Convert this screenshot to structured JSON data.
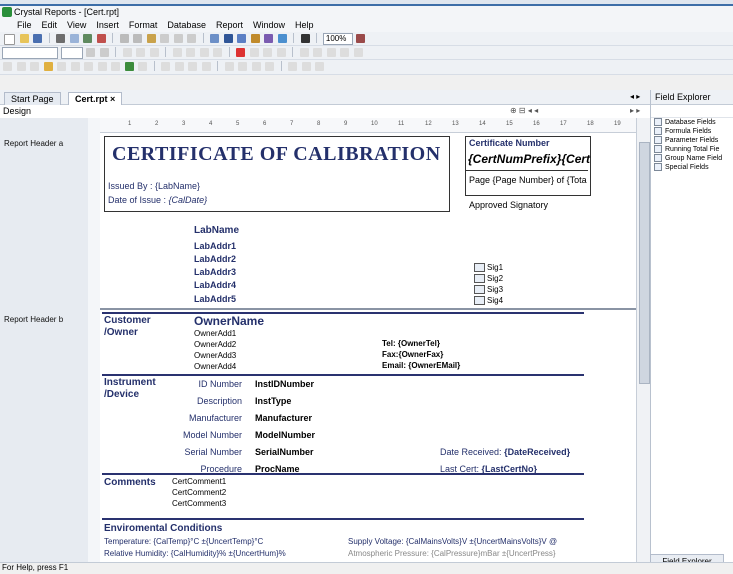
{
  "window": {
    "title": "Crystal Reports - [Cert.rpt]"
  },
  "menu": [
    "File",
    "Edit",
    "View",
    "Insert",
    "Format",
    "Database",
    "Report",
    "Window",
    "Help"
  ],
  "toolbar": {
    "zoom": "100%"
  },
  "tabs": [
    {
      "label": "Start Page"
    },
    {
      "label": "Cert.rpt"
    }
  ],
  "design_label": "Design",
  "sections": {
    "header_a": "Report Header a",
    "header_b": "Report Header b"
  },
  "ruler_numbers": [
    "1",
    "2",
    "3",
    "4",
    "5",
    "6",
    "7",
    "8",
    "9",
    "10",
    "11",
    "12",
    "13",
    "14",
    "15",
    "16",
    "17",
    "18",
    "19"
  ],
  "header_a": {
    "title": "CERTIFICATE OF CALIBRATION",
    "issued_by": "Issued By : {LabName}",
    "date_issue_label": "Date of Issue :",
    "date_issue_field": "{CalDate}",
    "cert_number_label": "Certificate Number",
    "cert_number_field": "{CertNumPrefix}{Cert",
    "page_field": "Page {Page Number} of {Tota",
    "approved": "Approved Signatory",
    "lab_fields": [
      "LabName",
      "LabAddr1",
      "LabAddr2",
      "LabAddr3",
      "LabAddr4",
      "LabAddr5"
    ],
    "sigs": [
      "Sig1",
      "Sig2",
      "Sig3",
      "Sig4"
    ]
  },
  "header_b": {
    "customer_label": "Customer",
    "owner_label": "/Owner",
    "owner_name": "OwnerName",
    "owner_addr": [
      "OwnerAdd1",
      "OwnerAdd2",
      "OwnerAdd3",
      "OwnerAdd4"
    ],
    "tel": "Tel: {OwnerTel}",
    "fax": "Fax:{OwnerFax}",
    "email": "Email: {OwnerEMail}",
    "instrument_label": "Instrument",
    "device_label": "/Device",
    "instrument_rows": [
      {
        "label": "ID Number",
        "value": "InstIDNumber"
      },
      {
        "label": "Description",
        "value": "InstType"
      },
      {
        "label": "Manufacturer",
        "value": "Manufacturer"
      },
      {
        "label": "Model Number",
        "value": "ModelNumber"
      },
      {
        "label": "Serial Number",
        "value": "SerialNumber"
      },
      {
        "label": "Procedure",
        "value": "ProcName"
      }
    ],
    "date_received_label": "Date Received:",
    "date_received_field": "{DateReceived}",
    "last_cert_label": "Last Cert:",
    "last_cert_field": "{LastCertNo}",
    "comments_label": "Comments",
    "comments": [
      "CertComment1",
      "CertComment2",
      "CertComment3"
    ],
    "env_label": "Enviromental Conditions",
    "temperature": "Temperature: {CalTemp}°C ±{UncertTemp}°C",
    "humidity": "Relative Humidity: {CalHumidity}% ±{UncertHum}%",
    "supply": "Supply Voltage: {CalMainsVolts}V ±{UncertMainsVolts}V @",
    "pressure": "Atmospheric Pressure: {CalPressure}mBar ±{UncertPress}"
  },
  "field_explorer": {
    "title": "Field Explorer",
    "items": [
      "Database Fields",
      "Formula Fields",
      "Parameter Fields",
      "Running Total Fie",
      "Group Name Field",
      "Special Fields"
    ],
    "tab_label": "Field Explorer"
  },
  "status": "For Help, press F1"
}
